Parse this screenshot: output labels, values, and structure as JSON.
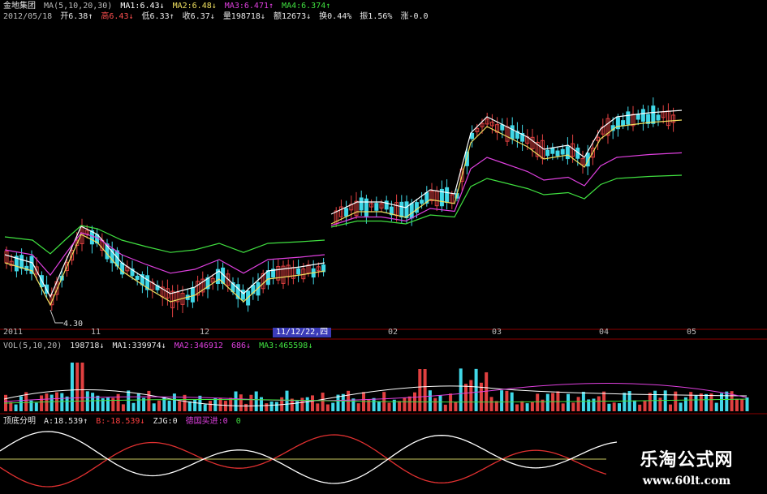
{
  "header": {
    "line1": [
      {
        "text": "金地集团",
        "color": "#e8e8e8"
      },
      {
        "text": "MA(5,10,20,30)",
        "color": "#bbbbbb"
      },
      {
        "text": "MA1:6.43↓",
        "color": "#ffffff"
      },
      {
        "text": "MA2:6.48↓",
        "color": "#f0e060"
      },
      {
        "text": "MA3:6.471↑",
        "color": "#e040e0"
      },
      {
        "text": "MA4:6.374↑",
        "color": "#40e040"
      }
    ],
    "line2": [
      {
        "text": "2012/05/18",
        "color": "#bbbbbb"
      },
      {
        "text": "开6.38↑",
        "color": "#e8e8e8"
      },
      {
        "text": "高6.43↓",
        "color": "#ff5050"
      },
      {
        "text": "低6.33↑",
        "color": "#e8e8e8"
      },
      {
        "text": "收6.37↓",
        "color": "#e8e8e8"
      },
      {
        "text": "量198718↓",
        "color": "#e8e8e8"
      },
      {
        "text": "额12673↓",
        "color": "#e8e8e8"
      },
      {
        "text": "换0.44%",
        "color": "#e8e8e8"
      },
      {
        "text": "振1.56%",
        "color": "#e8e8e8"
      },
      {
        "text": "涨-0.0",
        "color": "#e8e8e8"
      }
    ]
  },
  "price_panel": {
    "low_label": "4.30",
    "axis_months": [
      "2011",
      "11",
      "12",
      "02",
      "03",
      "04",
      "05"
    ],
    "cursor_date": "11/12/22,四"
  },
  "volume_panel": {
    "title_items": [
      {
        "text": "VOL(5,10,20)",
        "color": "#bbbbbb"
      },
      {
        "text": "198718↓",
        "color": "#e8e8e8"
      },
      {
        "text": "MA1:339974↓",
        "color": "#e8e8e8"
      },
      {
        "text": "MA2:346912",
        "color": "#e040e0"
      },
      {
        "text": "686↓",
        "color": "#e040e0"
      },
      {
        "text": "MA3:465598↓",
        "color": "#40e040"
      }
    ]
  },
  "indicator_panel": {
    "title_items": [
      {
        "text": "顶底分明",
        "color": "#e8e8e8"
      },
      {
        "text": "A:18.539↑",
        "color": "#e8e8e8"
      },
      {
        "text": "B:-18.539↓",
        "color": "#ff4040"
      },
      {
        "text": "ZJG:0",
        "color": "#e8e8e8"
      },
      {
        "text": "德国买进:0",
        "color": "#e040e0"
      },
      {
        "text": "0",
        "color": "#40e040"
      }
    ]
  },
  "watermark": {
    "cn": "乐淘公式网",
    "url": "www.60lt.com"
  },
  "colors": {
    "up": "#e04040",
    "down": "#40d8e8",
    "ma1": "#ffffff",
    "ma2": "#f0e060",
    "ma3": "#e040e0",
    "ma4": "#40e040",
    "grid": "#8b0000"
  }
}
